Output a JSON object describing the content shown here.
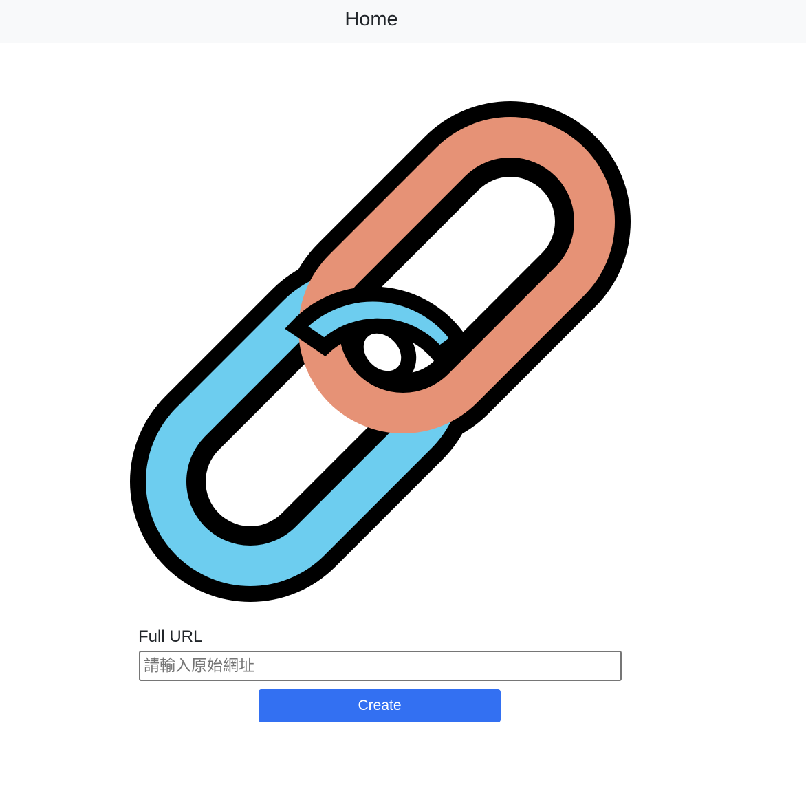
{
  "nav": {
    "home_label": "Home"
  },
  "logo": {
    "icon": "chain-link-icon",
    "colors": {
      "left_link": "#6dcdef",
      "right_link": "#e69276",
      "outline": "#000000"
    }
  },
  "form": {
    "label": "Full URL",
    "input_value": "",
    "input_placeholder": "請輸入原始網址",
    "submit_label": "Create",
    "submit_color": "#3370f2"
  }
}
